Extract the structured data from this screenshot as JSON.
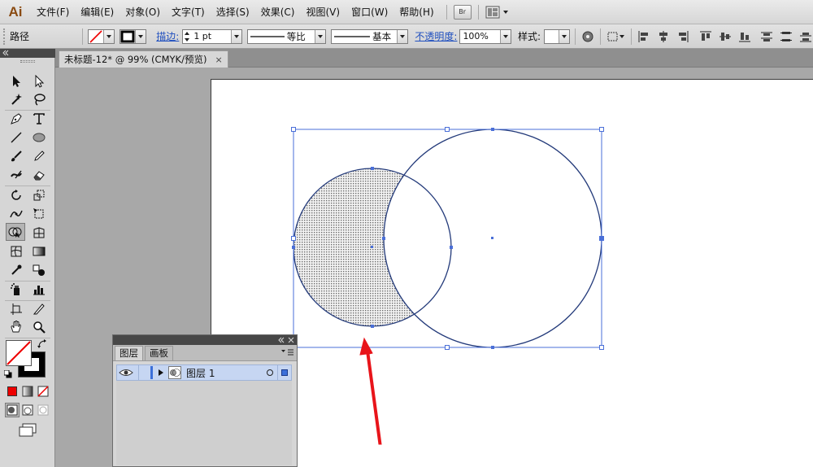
{
  "app": {
    "logo": "Ai"
  },
  "menu": [
    "文件(F)",
    "编辑(E)",
    "对象(O)",
    "文字(T)",
    "选择(S)",
    "效果(C)",
    "视图(V)",
    "窗口(W)",
    "帮助(H)"
  ],
  "menubar_buttons": {
    "bridge": "Br"
  },
  "control": {
    "selection_type": "路径",
    "stroke_label": "描边:",
    "stroke_weight": "1 pt",
    "profile_label": "等比",
    "brush_label": "基本",
    "opacity_label": "不透明度:",
    "opacity_value": "100%",
    "style_label": "样式:"
  },
  "document": {
    "tab_title": "未标题-12* @ 99% (CMYK/预览)",
    "close_glyph": "×"
  },
  "layers_panel": {
    "tabs": [
      "图层",
      "画板"
    ],
    "layer_name": "图层 1"
  },
  "colors": {
    "selection": "#4a6fd8",
    "arrow": "#e8141a",
    "accent_logo": "#8a4b12"
  }
}
